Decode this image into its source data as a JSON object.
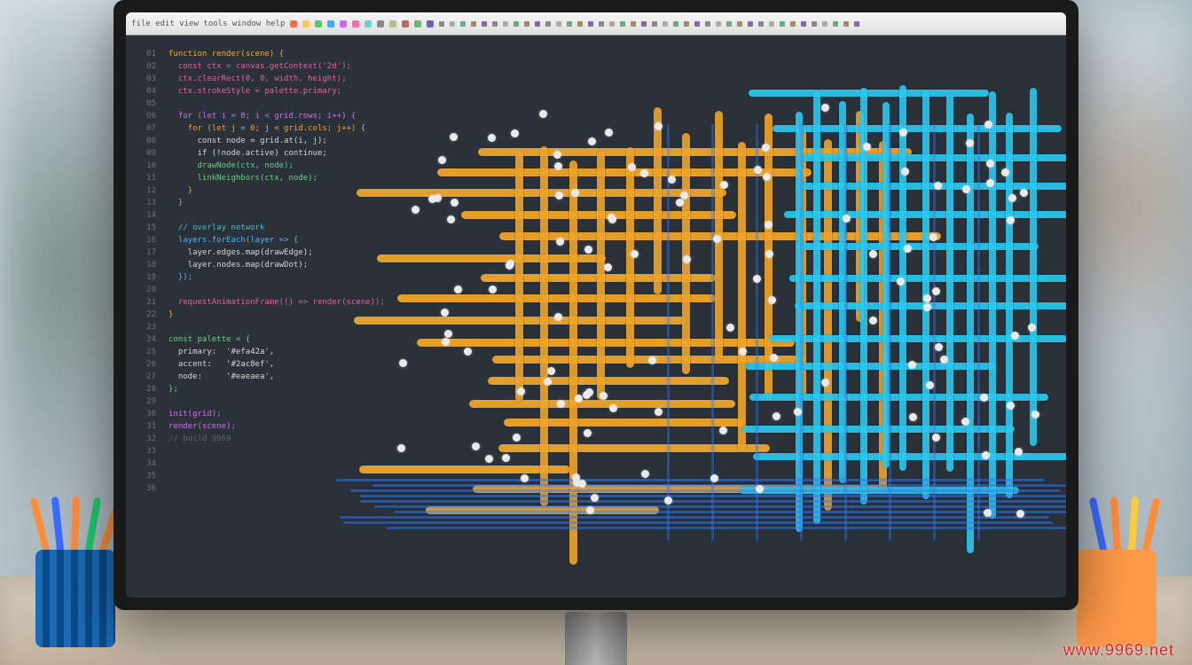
{
  "scene": {
    "description": "photoreal-style illustration of a computer monitor on a desk showing a dark-theme code editor with an overlaid abstract orange/cyan grid visualization; pen cups on both sides; blurred office shelf and plant in background",
    "watermark": "www.9969.net"
  },
  "editor": {
    "toolbar_hint": "file edit view tools window help",
    "toolbar_dots": [
      "#ff6a4a",
      "#ffc84a",
      "#5ac85a",
      "#4aa8ff",
      "#c86aff",
      "#ff6aa8",
      "#6dd0d0",
      "#888",
      "#bb8",
      "#b66",
      "#6b6",
      "#66b"
    ],
    "gutter_start": 1,
    "gutter_end": 36,
    "lines": [
      {
        "cls": "c-orange",
        "txt": "function render(scene) {"
      },
      {
        "cls": "c-magenta",
        "txt": "  const ctx = canvas.getContext('2d');"
      },
      {
        "cls": "c-magenta",
        "txt": "  ctx.clearRect(0, 0, width, height);"
      },
      {
        "cls": "c-magenta",
        "txt": "  ctx.strokeStyle = palette.primary;"
      },
      {
        "cls": "c-dim",
        "txt": ""
      },
      {
        "cls": "c-purple",
        "txt": "  for (let i = 0; i < grid.rows; i++) {"
      },
      {
        "cls": "c-orange",
        "txt": "    for (let j = 0; j < grid.cols; j++) {"
      },
      {
        "cls": "c-white",
        "txt": "      const node = grid.at(i, j);"
      },
      {
        "cls": "c-white",
        "txt": "      if (!node.active) continue;"
      },
      {
        "cls": "c-green",
        "txt": "      drawNode(ctx, node);"
      },
      {
        "cls": "c-green",
        "txt": "      linkNeighbors(ctx, node);"
      },
      {
        "cls": "c-orange",
        "txt": "    }"
      },
      {
        "cls": "c-purple",
        "txt": "  }"
      },
      {
        "cls": "c-dim",
        "txt": ""
      },
      {
        "cls": "c-cyan",
        "txt": "  // overlay network"
      },
      {
        "cls": "c-blue",
        "txt": "  layers.forEach(layer => {"
      },
      {
        "cls": "c-white",
        "txt": "    layer.edges.map(drawEdge);"
      },
      {
        "cls": "c-white",
        "txt": "    layer.nodes.map(drawDot);"
      },
      {
        "cls": "c-blue",
        "txt": "  });"
      },
      {
        "cls": "c-dim",
        "txt": ""
      },
      {
        "cls": "c-magenta",
        "txt": "  requestAnimationFrame(() => render(scene));"
      },
      {
        "cls": "c-orange",
        "txt": "}"
      },
      {
        "cls": "c-dim",
        "txt": ""
      },
      {
        "cls": "c-green",
        "txt": "const palette = {"
      },
      {
        "cls": "c-white",
        "txt": "  primary:  '#efa42a',"
      },
      {
        "cls": "c-white",
        "txt": "  accent:   '#2ac8ef',"
      },
      {
        "cls": "c-white",
        "txt": "  node:     '#eaeaea',"
      },
      {
        "cls": "c-green",
        "txt": "};"
      },
      {
        "cls": "c-dim",
        "txt": ""
      },
      {
        "cls": "c-purple",
        "txt": "init(grid);"
      },
      {
        "cls": "c-purple",
        "txt": "render(scene);"
      },
      {
        "cls": "c-dim",
        "txt": "// build 9969"
      },
      {
        "cls": "c-dim",
        "txt": ""
      },
      {
        "cls": "c-dim",
        "txt": ""
      },
      {
        "cls": "c-dim",
        "txt": ""
      },
      {
        "cls": "c-dim",
        "txt": ""
      }
    ]
  },
  "colors": {
    "editor_bg": "#2a3139",
    "grid_orange": "#efa42a",
    "grid_cyan": "#2ac8ef",
    "grid_blue": "#3a78e0",
    "dot": "#eaeaea"
  }
}
